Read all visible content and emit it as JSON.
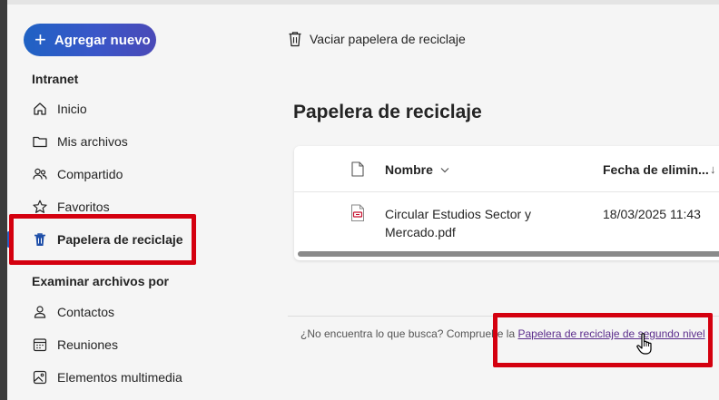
{
  "sidebar": {
    "add_button_label": "Agregar nuevo",
    "section_intranet": "Intranet",
    "items": [
      {
        "label": "Inicio",
        "icon": "home-icon"
      },
      {
        "label": "Mis archivos",
        "icon": "folder-icon"
      },
      {
        "label": "Compartido",
        "icon": "people-icon"
      },
      {
        "label": "Favoritos",
        "icon": "star-icon"
      },
      {
        "label": "Papelera de reciclaje",
        "icon": "trash-icon",
        "active": true
      }
    ],
    "section_browse": "Examinar archivos por",
    "browse_items": [
      {
        "label": "Contactos",
        "icon": "person-icon"
      },
      {
        "label": "Reuniones",
        "icon": "calendar-icon"
      },
      {
        "label": "Elementos multimedia",
        "icon": "image-icon"
      }
    ]
  },
  "toolbar": {
    "empty_recycle_label": "Vaciar papelera de reciclaje"
  },
  "main": {
    "title": "Papelera de reciclaje",
    "columns": {
      "name": "Nombre",
      "date_deleted": "Fecha de elimin..."
    },
    "files": [
      {
        "name": "Circular Estudios Sector y Mercado.pdf",
        "date": "18/03/2025 11:43",
        "type": "pdf"
      }
    ]
  },
  "footer": {
    "prompt": "¿No encuentra lo que busca? Compruebe la ",
    "link": "Papelera de reciclaje de segundo nivel"
  },
  "colors": {
    "accent": "#1f62c4",
    "highlight": "#d4000f",
    "link": "#5b2d8c"
  }
}
